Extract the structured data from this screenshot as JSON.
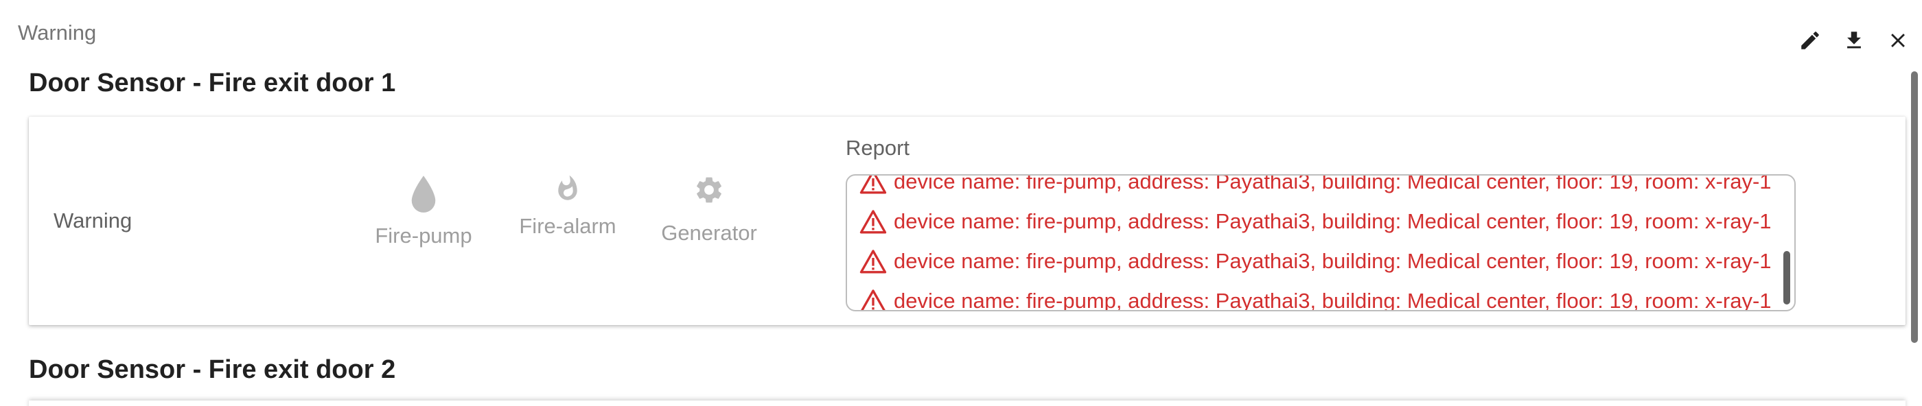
{
  "widget": {
    "title": "Warning"
  },
  "toolbar": {
    "edit_icon": "pencil-icon",
    "download_icon": "download-icon",
    "close_icon": "close-icon"
  },
  "sections": [
    {
      "title": "Door Sensor - Fire exit door 1",
      "status": "Warning",
      "devices": [
        {
          "label": "Fire-pump",
          "icon": "water-drop-icon"
        },
        {
          "label": "Fire-alarm",
          "icon": "fire-icon"
        },
        {
          "label": "Generator",
          "icon": "gear-icon"
        }
      ],
      "report": {
        "label": "Report",
        "items": [
          "device name: fire-pump, address: Payathai3, building: Medical center, floor: 19, room: x-ray-1",
          "device name: fire-pump, address: Payathai3, building: Medical center, floor: 19, room: x-ray-1",
          "device name: fire-pump, address: Payathai3, building: Medical center, floor: 19, room: x-ray-1",
          "device name: fire-pump, address: Payathai3, building: Medical center, floor: 19, room: x-ray-1"
        ],
        "item_icon": "warning-triangle-icon"
      }
    },
    {
      "title": "Door Sensor - Fire exit door 2"
    }
  ],
  "colors": {
    "alert_text": "#d32f2f",
    "inactive_icon": "#bdbdbd",
    "inactive_text": "#9e9e9e"
  }
}
